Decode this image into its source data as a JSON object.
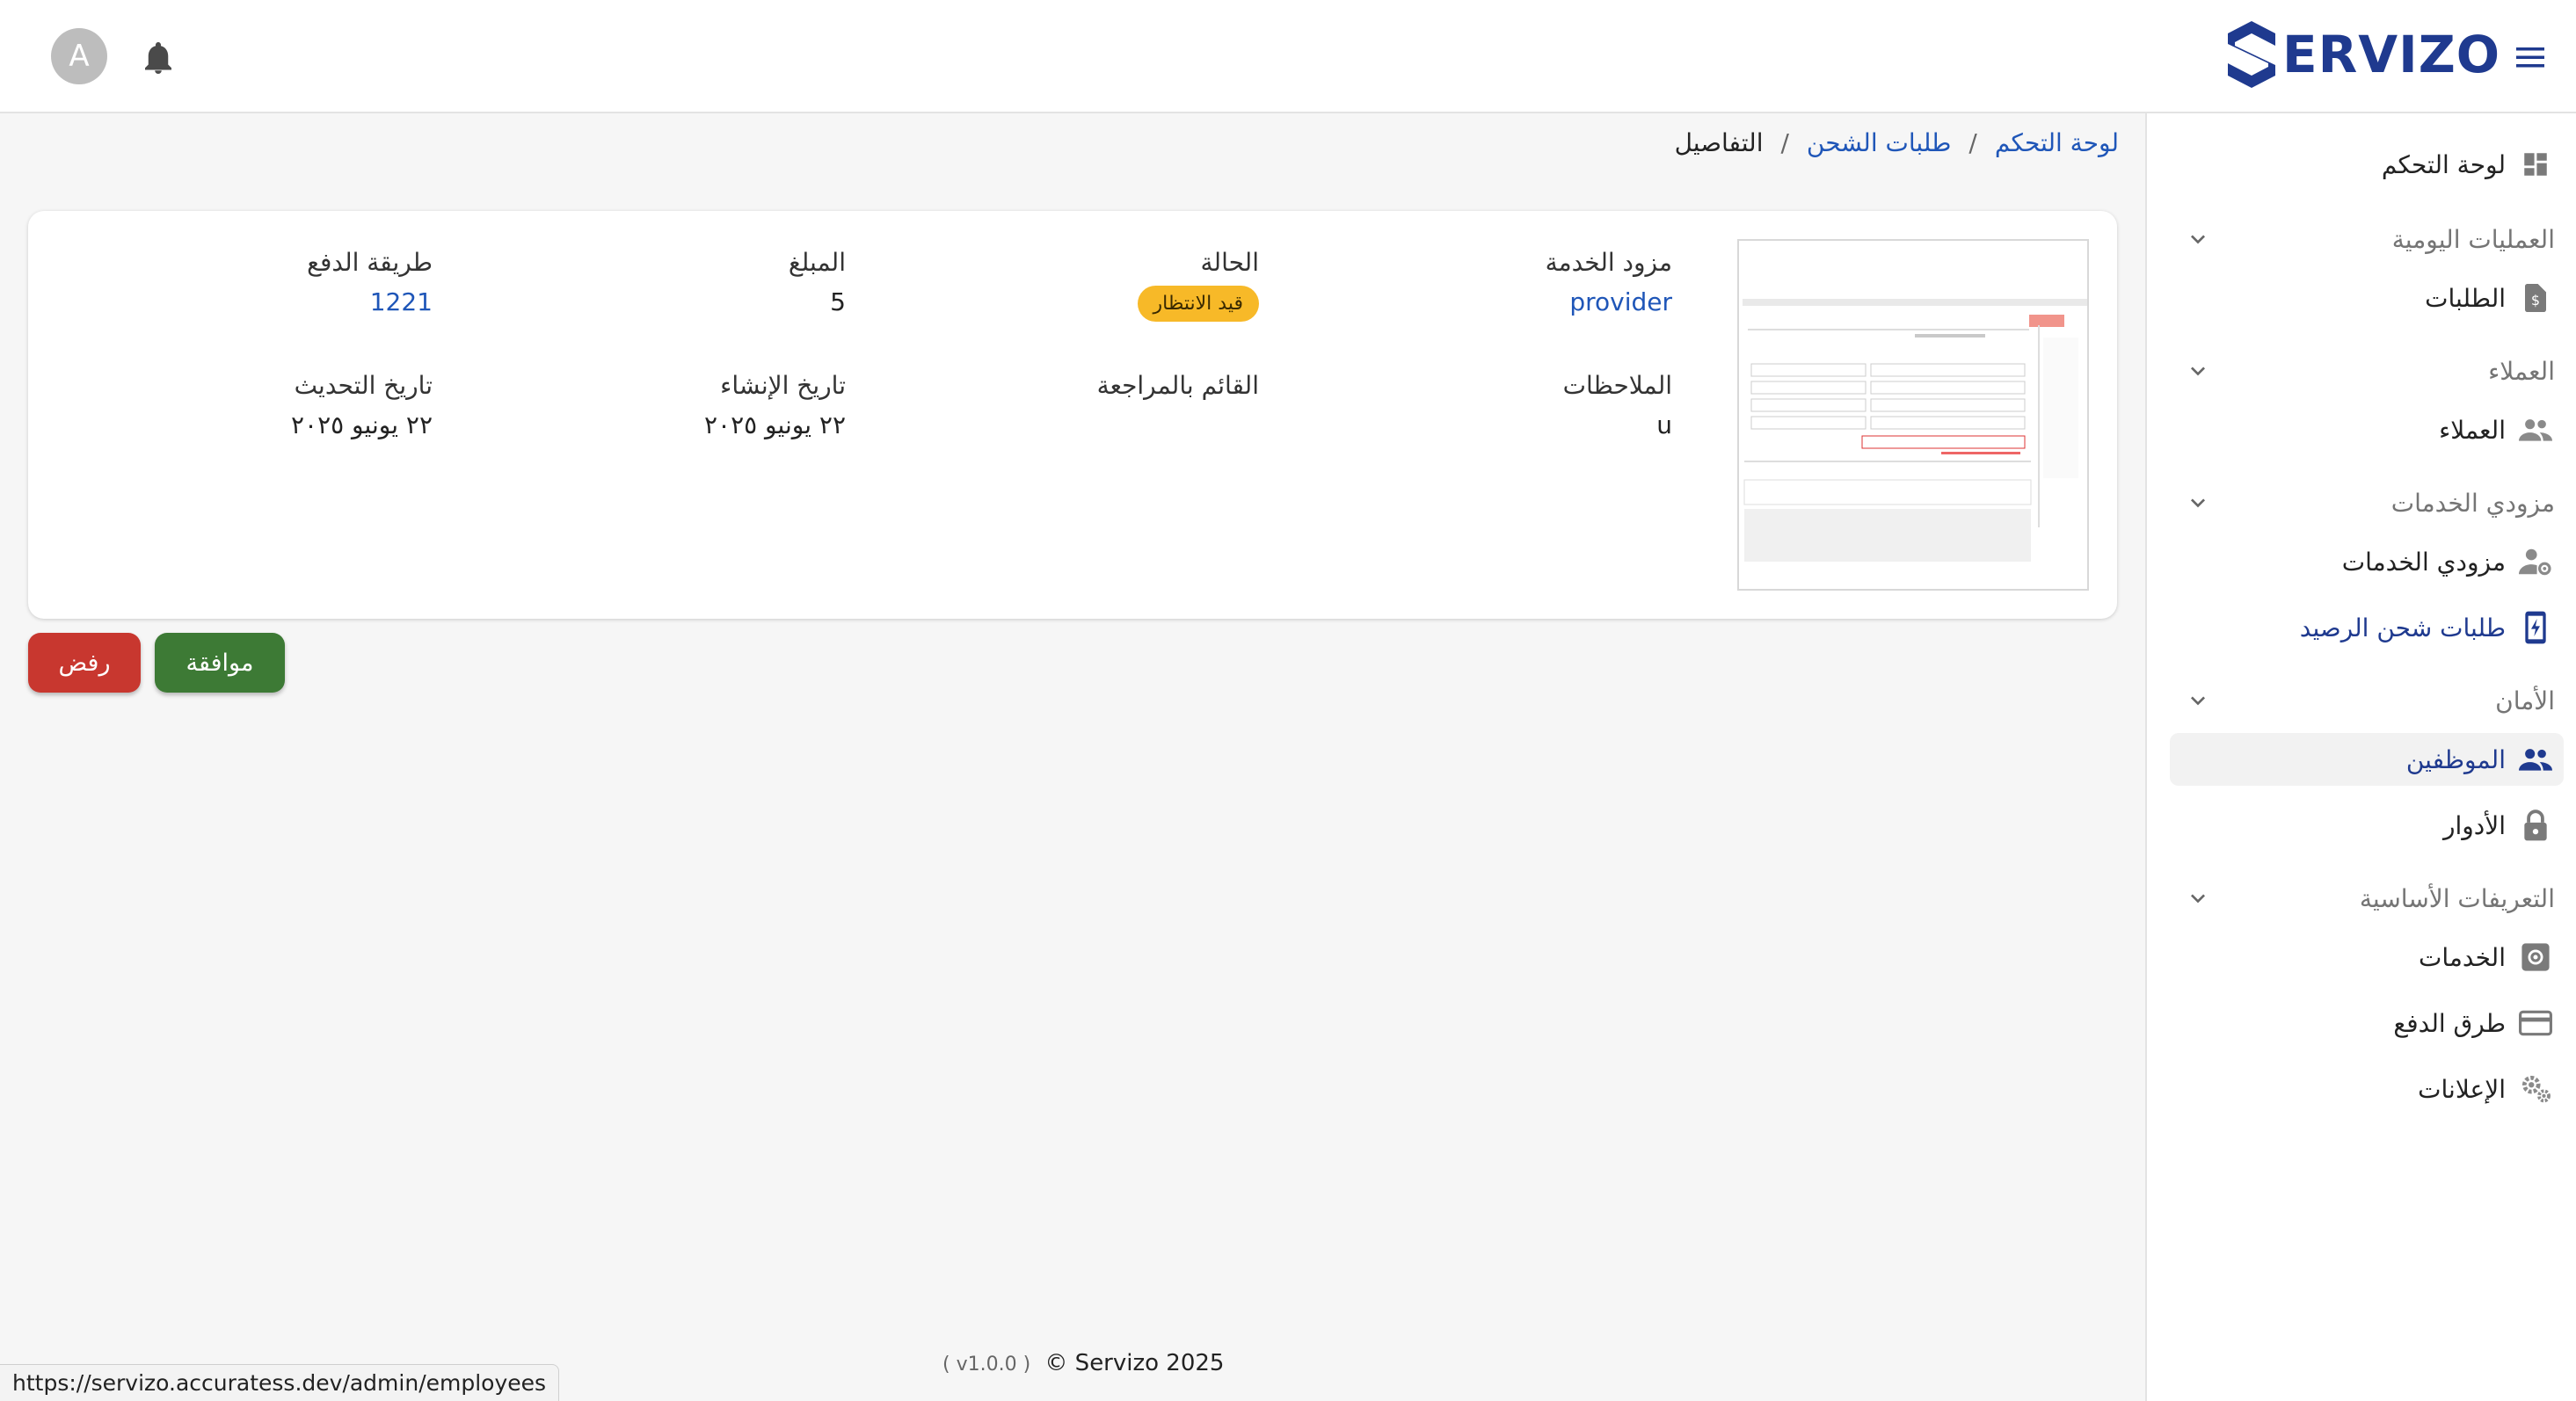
{
  "header": {
    "brand": "ERVIZO",
    "avatar_letter": "A",
    "colors": {
      "brand": "#1f3a8f",
      "link": "#1f56b8"
    }
  },
  "sidebar": {
    "dashboard": "لوحة التحكم",
    "section_daily": "العمليات اليومية",
    "orders": "الطلبات",
    "section_customers": "العملاء",
    "customers": "العملاء",
    "section_providers": "مزودي الخدمات",
    "providers": "مزودي الخدمات",
    "topup_requests": "طلبات شحن الرصيد",
    "section_security": "الأمان",
    "employees": "الموظفين",
    "roles": "الأدوار",
    "section_basics": "التعريفات الأساسية",
    "services": "الخدمات",
    "payment_methods": "طرق الدفع",
    "ads": "الإعلانات"
  },
  "breadcrumb": {
    "home": "لوحة التحكم",
    "topups": "طلبات الشحن",
    "current": "التفاصيل",
    "separator": "/"
  },
  "details": {
    "provider_label": "مزود الخدمة",
    "provider_value": "provider",
    "status_label": "الحالة",
    "status_value": "قيد الانتظار",
    "amount_label": "المبلغ",
    "amount_value": "5",
    "payment_label": "طريقة الدفع",
    "payment_value": "1221",
    "notes_label": "الملاحظات",
    "notes_value": "u",
    "reviewer_label": "القائم بالمراجعة",
    "created_label": "تاريخ الإنشاء",
    "created_value": "٢٢ يونيو ٢٠٢٥",
    "updated_label": "تاريخ التحديث",
    "updated_value": "٢٢ يونيو ٢٠٢٥"
  },
  "actions": {
    "approve": "موافقة",
    "reject": "رفض"
  },
  "footer": {
    "copyright": "© Servizo 2025",
    "version": "( v1.0.0 )"
  },
  "status_bar": {
    "url": "https://servizo.accuratess.dev/admin/employees"
  },
  "icons": [
    "hamburger-menu-icon",
    "bell-icon",
    "dashboard-icon",
    "chevron-down-icon",
    "receipt-dollar-icon",
    "people-icon",
    "person-gear-icon",
    "phone-charge-icon",
    "group-icon",
    "lock-icon",
    "settings-square-icon",
    "credit-card-icon",
    "gears-icon"
  ]
}
